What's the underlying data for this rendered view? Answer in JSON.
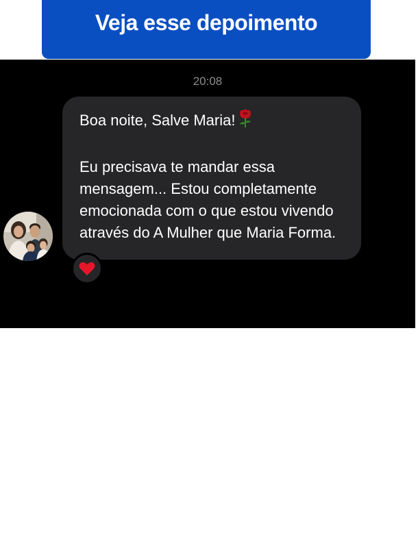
{
  "banner": {
    "title": "Veja esse depoimento",
    "color": "#0a4fc2"
  },
  "chat": {
    "timestamp": "20:08",
    "message": {
      "greeting": "Boa noite, Salve Maria!",
      "greeting_emoji": "rose-icon",
      "lines": [
        "Eu precisava te mandar essa",
        "mensagem... Estou completamente",
        "emocionada com o que estou vivendo",
        "através do A Mulher que Maria Forma."
      ],
      "reaction": "heart-icon"
    },
    "avatar": "family-photo-avatar"
  }
}
